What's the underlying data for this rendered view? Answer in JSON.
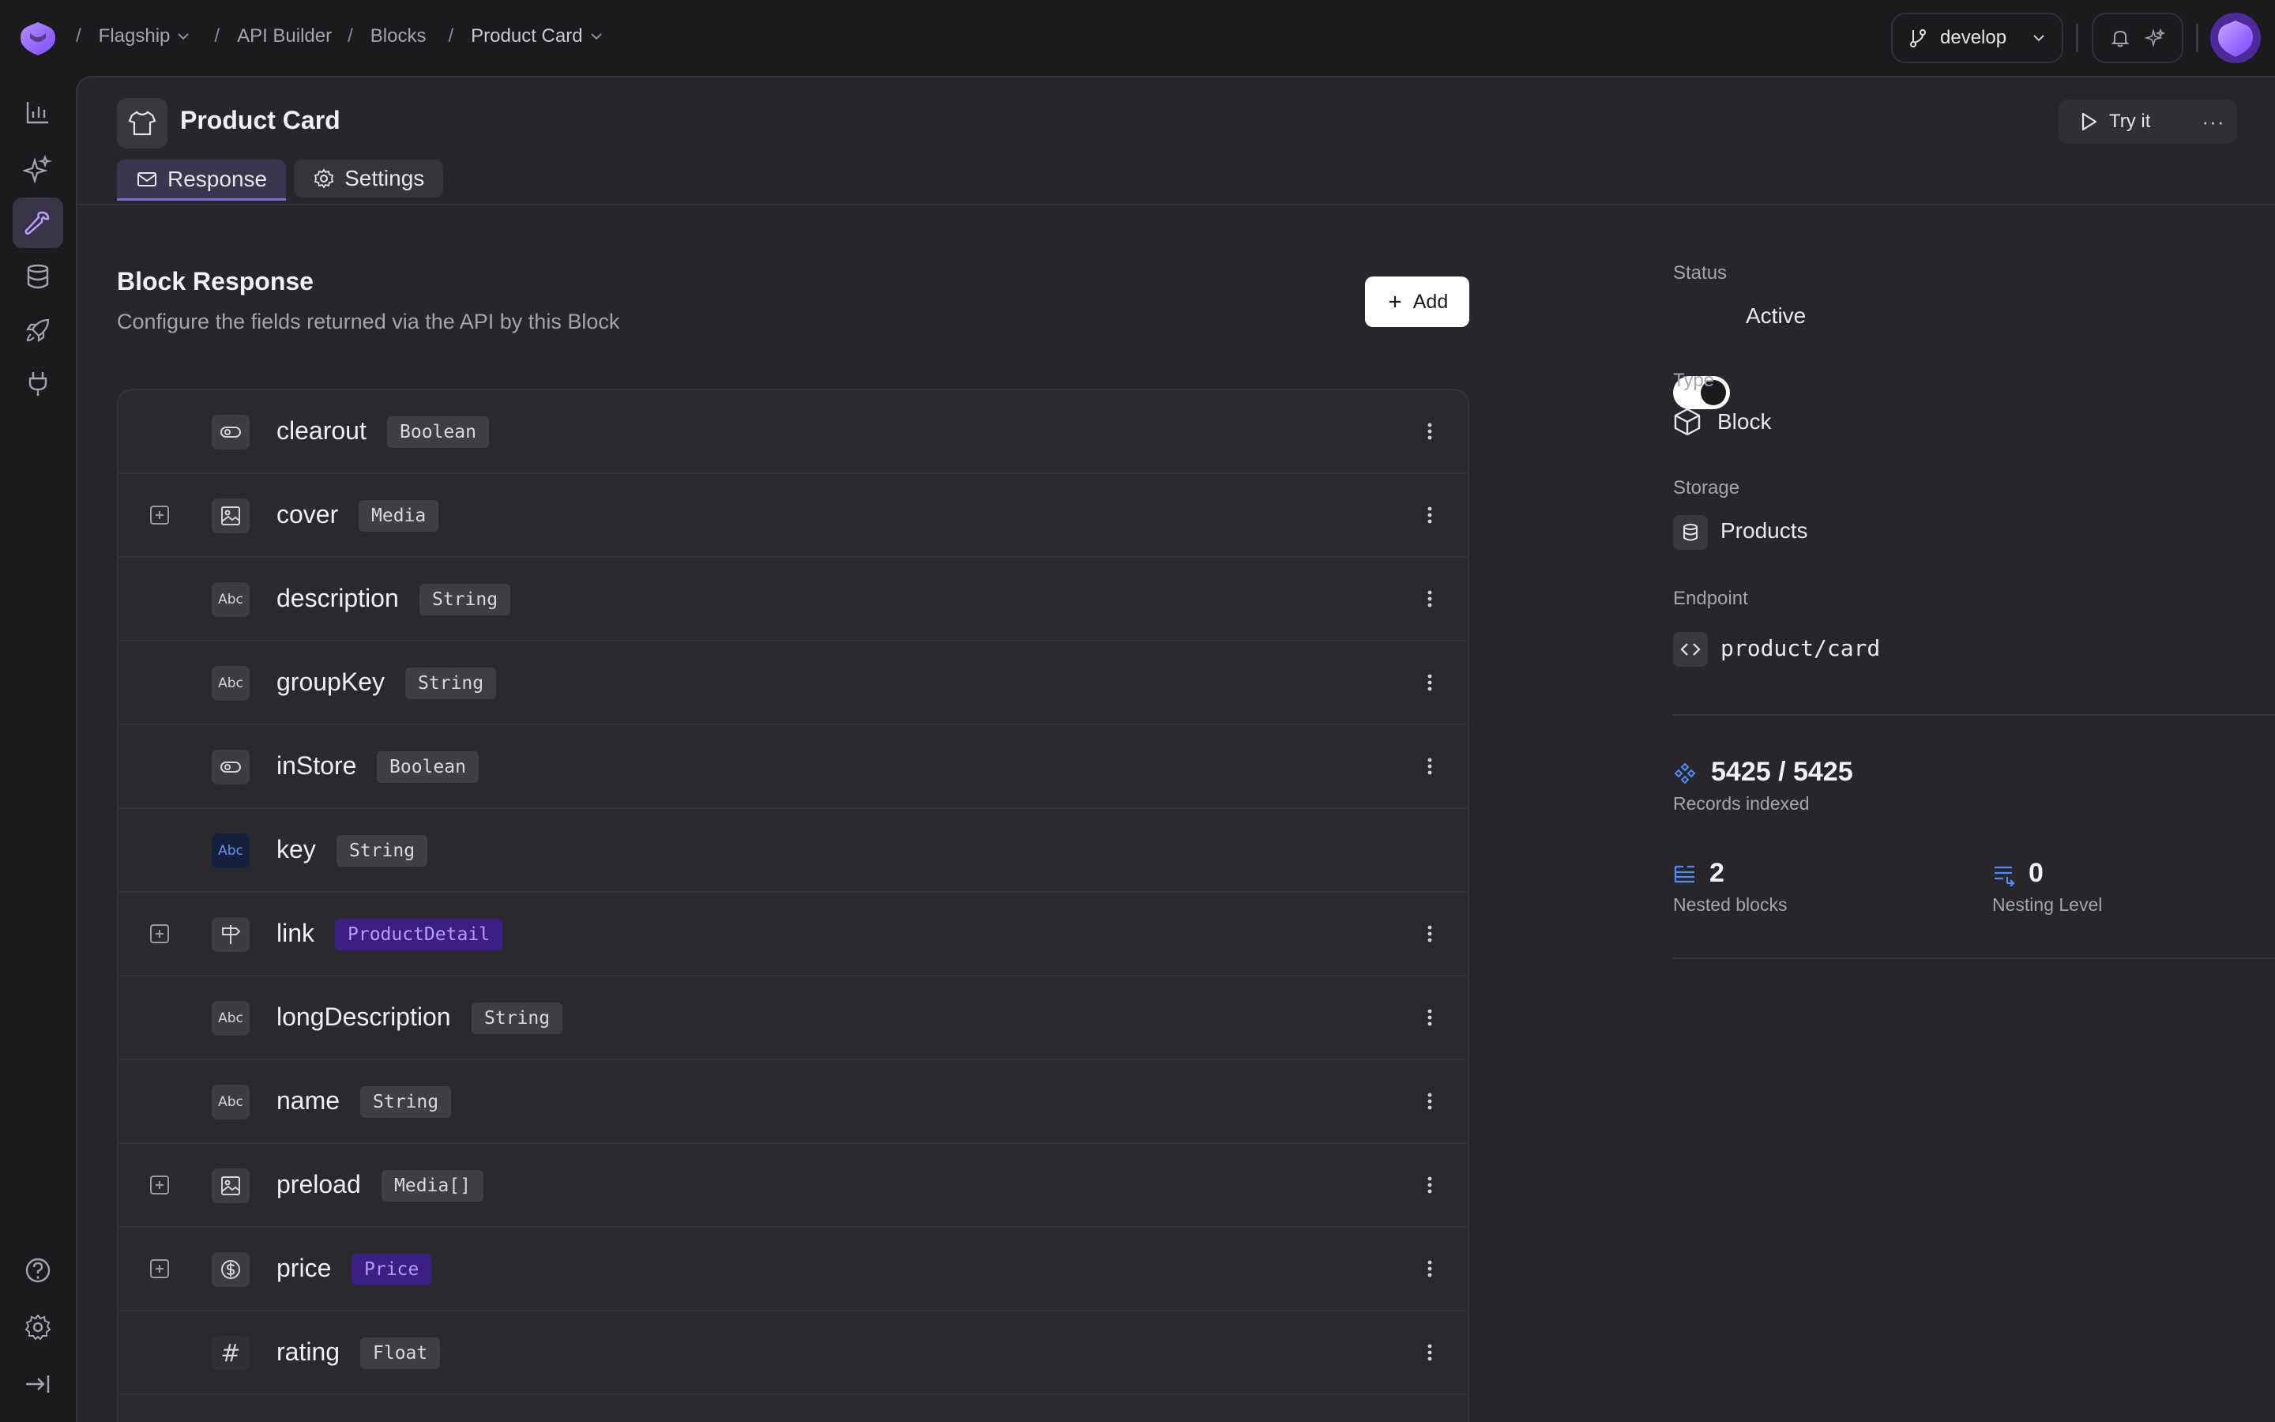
{
  "breadcrumb": [
    "Flagship",
    "API Builder",
    "Blocks",
    "Product Card"
  ],
  "branch": "develop",
  "page": {
    "title": "Product Card",
    "try_it": "Try it",
    "more": "···"
  },
  "tabs": [
    {
      "label": "Response",
      "icon": "mail-icon",
      "active": true
    },
    {
      "label": "Settings",
      "icon": "gear-icon",
      "active": false
    }
  ],
  "section": {
    "title": "Block Response",
    "subtitle": "Configure the fields returned via the API by this Block",
    "add_label": "Add"
  },
  "fields": [
    {
      "name": "clearout",
      "type": "Boolean",
      "icon": "toggle-icon",
      "expandable": false,
      "menu": true
    },
    {
      "name": "cover",
      "type": "Media",
      "icon": "image-icon",
      "expandable": true,
      "menu": true
    },
    {
      "name": "description",
      "type": "String",
      "icon": "abc-icon",
      "icon_text": "Abc",
      "expandable": false,
      "menu": true
    },
    {
      "name": "groupKey",
      "type": "String",
      "icon": "abc-icon",
      "icon_text": "Abc",
      "expandable": false,
      "menu": true
    },
    {
      "name": "inStore",
      "type": "Boolean",
      "icon": "toggle-icon",
      "expandable": false,
      "menu": true
    },
    {
      "name": "key",
      "type": "String",
      "icon": "abc-key-icon",
      "icon_text": "Abc",
      "expandable": false,
      "menu": false
    },
    {
      "name": "link",
      "type": "ProductDetail",
      "icon": "signpost-icon",
      "expandable": true,
      "menu": true,
      "purple": true
    },
    {
      "name": "longDescription",
      "type": "String",
      "icon": "abc-icon",
      "icon_text": "Abc",
      "expandable": false,
      "menu": true
    },
    {
      "name": "name",
      "type": "String",
      "icon": "abc-icon",
      "icon_text": "Abc",
      "expandable": false,
      "menu": true
    },
    {
      "name": "preload",
      "type": "Media[]",
      "icon": "image-icon",
      "expandable": true,
      "menu": true
    },
    {
      "name": "price",
      "type": "Price",
      "icon": "dollar-icon",
      "expandable": true,
      "menu": true,
      "purple": true
    },
    {
      "name": "rating",
      "type": "Float",
      "icon": "hash-icon",
      "icon_text": "#",
      "expandable": false,
      "menu": true
    }
  ],
  "info": {
    "status_label": "Status",
    "status_value": "Active",
    "type_label": "Type",
    "type_value": "Block",
    "storage_label": "Storage",
    "storage_value": "Products",
    "endpoint_label": "Endpoint",
    "endpoint_value": "product/card",
    "records_value": "5425 / 5425",
    "records_label": "Records indexed",
    "nested_value": "2",
    "nested_label": "Nested blocks",
    "nesting_value": "0",
    "nesting_label": "Nesting Level"
  },
  "colors": {
    "accent": "#7c6fd4",
    "purple_badge": "#3c1f84",
    "blue_icon": "#4f8cf7"
  }
}
